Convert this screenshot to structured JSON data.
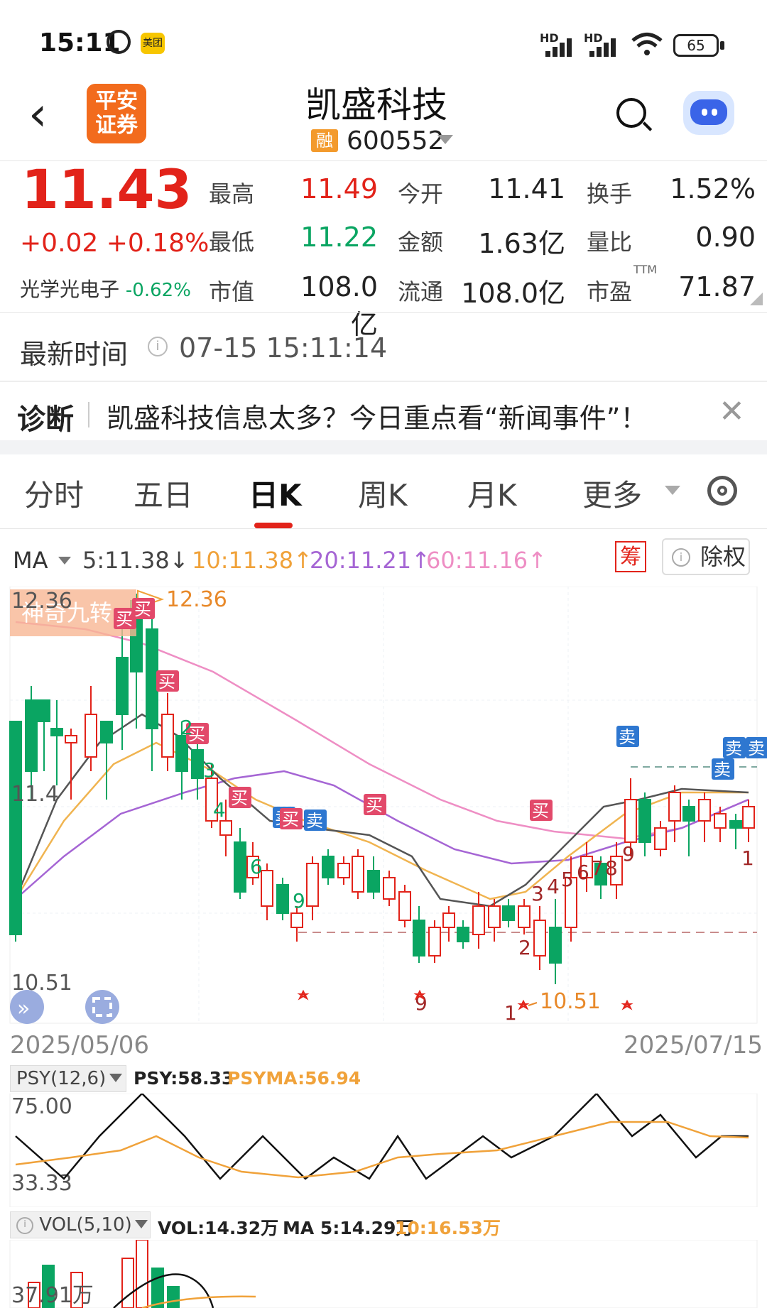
{
  "status_bar": {
    "time": "15:11",
    "app_badge": "美团",
    "sig1": "HD",
    "sig2": "HD",
    "battery": "65"
  },
  "header": {
    "logo_line1": "平安",
    "logo_line2": "证券",
    "title": "凯盛科技",
    "rong": "融",
    "code": "600552"
  },
  "quote": {
    "price": "11.43",
    "change": "+0.02 +0.18%",
    "sector_name": "光学光电子",
    "sector_change": "-0.62%",
    "rows": [
      [
        {
          "label": "最高",
          "value": "11.49",
          "tone": "red"
        },
        {
          "label": "今开",
          "value": "11.41",
          "tone": "dark"
        },
        {
          "label": "换手",
          "value": "1.52%",
          "tone": "dark"
        }
      ],
      [
        {
          "label": "最低",
          "value": "11.22",
          "tone": "green"
        },
        {
          "label": "金额",
          "value": "1.63亿",
          "tone": "dark"
        },
        {
          "label": "量比",
          "value": "0.90",
          "tone": "dark"
        }
      ],
      [
        {
          "label": "市值",
          "value": "108.0亿",
          "tone": "dark"
        },
        {
          "label": "流通",
          "value": "108.0亿",
          "tone": "dark"
        },
        {
          "label": "市盈",
          "value": "71.87",
          "tone": "dark"
        }
      ]
    ],
    "ttm": "TTM"
  },
  "latest_time": {
    "label": "最新时间",
    "info": "i",
    "value": "07-15 15:11:14"
  },
  "diagnosis": {
    "label": "诊断",
    "text": "凯盛科技信息太多？今日重点看“新闻事件”！",
    "close": "✕"
  },
  "tabs": [
    "分时",
    "五日",
    "日K",
    "周K",
    "月K",
    "更多"
  ],
  "active_tab": "日K",
  "ma_legend": {
    "ma": "MA",
    "ma5": "5:11.38↓",
    "ma10": "10:11.38↑",
    "ma20": "20:11.21↑",
    "ma60": "60:11.16↑",
    "chou": "筹",
    "chuquan": "除权"
  },
  "colors": {
    "up": "#e2231a",
    "down": "#0aa562",
    "ma5": "#555555",
    "ma10": "#f0a23a",
    "ma20": "#a565d4",
    "ma60": "#ee8ec4",
    "blue": "#2e77d0"
  },
  "kline": {
    "y_high_label": "12.36",
    "y_mid_label": "11.4",
    "y_low_label": "10.51",
    "max_marker": "12.36",
    "min_marker": "10.51",
    "nine_turn": "神奇九转",
    "start_date": "2025/05/06",
    "end_date": "2025/07/15",
    "buy": "买",
    "sell": "卖",
    "ylim": [
      10.51,
      12.36
    ]
  },
  "psy": {
    "box": "PSY(12,6)",
    "psy": "PSY:58.33",
    "psyma": "PSYMA:56.94",
    "top_label": "75.00",
    "bottom_label": "33.33"
  },
  "vol": {
    "box": "VOL(5,10)",
    "vol": "VOL:14.32万",
    "ma5": "MA 5:14.29万",
    "ma10": "10:16.53万",
    "label": "37.91万",
    "info": "i"
  }
}
